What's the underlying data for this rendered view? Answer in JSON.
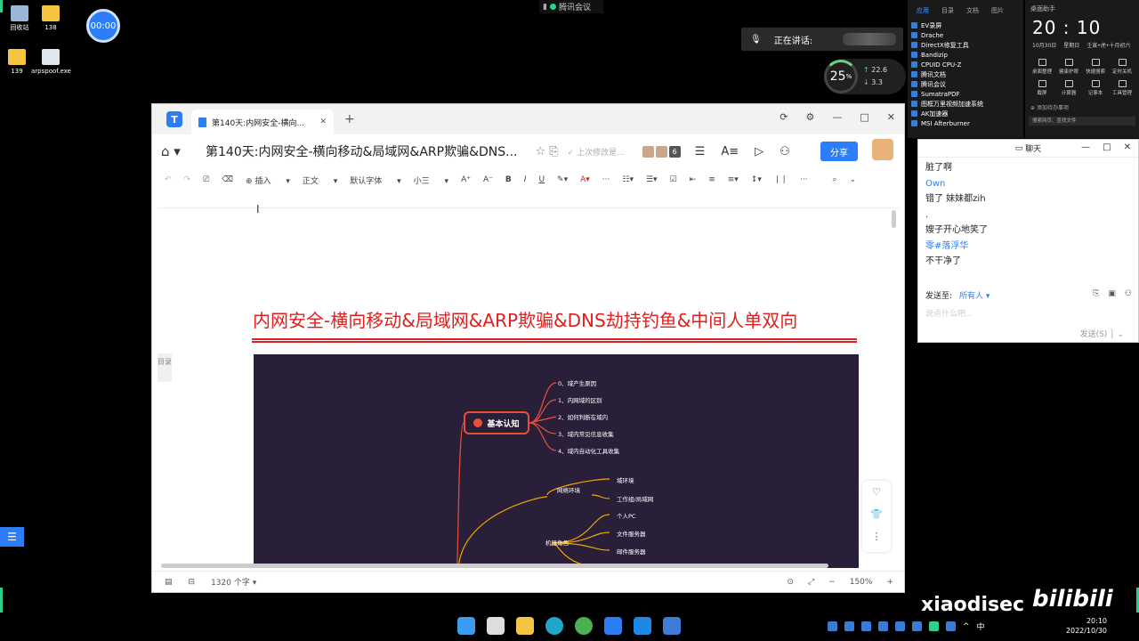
{
  "desktop": {
    "icons": [
      {
        "label": "回收站"
      },
      {
        "label": "138"
      },
      {
        "label": "139"
      },
      {
        "label": "arpspoof.exe"
      }
    ],
    "timer": "00:00"
  },
  "meeting": {
    "app_name": "腾讯会议",
    "speaking_label": "正在讲话:"
  },
  "perf": {
    "cpu": "25",
    "cpu_unit": "%",
    "up": "22.6",
    "down": "3.3"
  },
  "apps_panel": {
    "tabs": [
      "应用",
      "目录",
      "文档",
      "图片"
    ],
    "items": [
      "EV录屏",
      "Drache",
      "DirectX修复工具",
      "Bandizip",
      "CPUID CPU-Z",
      "腾讯文档",
      "腾讯会议",
      "SumatraPDF",
      "图框万里视频加速系统",
      "AK加速器",
      "MSI Afterburner"
    ]
  },
  "clock_panel": {
    "title": "桌面助手",
    "time": "20 : 10",
    "date": "10月30日",
    "weekday": "星期日",
    "lunar": "壬寅•虎•十月初六",
    "tools": [
      "桌面整理",
      "健康护眼",
      "快捷搜索",
      "定时关机",
      "截屏",
      "计算器",
      "记事本",
      "工具管理"
    ],
    "todo": "添加待办事项",
    "search_placeholder": "搜索网页、查找文件"
  },
  "chat": {
    "title": "聊天",
    "messages": [
      {
        "text": "脏了啊",
        "name": false
      },
      {
        "text": "Own",
        "name": true
      },
      {
        "text": "错了  妹妹都zih",
        "name": false
      },
      {
        "text": ".",
        "name": false
      },
      {
        "text": "嫂子开心地笑了",
        "name": false
      },
      {
        "text": "零#落浮华",
        "name": true
      },
      {
        "text": "不干净了",
        "name": false
      }
    ],
    "send_to_label": "发送至:",
    "send_to_value": "所有人",
    "input_placeholder": "说点什么吧...",
    "send_button": "发送(S)"
  },
  "doc_window": {
    "tab_title": "第140天:内网安全-横向...",
    "doc_title": "第140天:内网安全-横向移动&局域网&ARP欺骗&DNS...",
    "saved_status": "上次修改是...",
    "collaborators_count": "6",
    "share_button": "分享",
    "toolbar": {
      "insert": "插入",
      "style": "正文",
      "font": "默认字体",
      "size": "小三"
    },
    "heading": "内网安全-横向移动&局域网&ARP欺骗&DNS劫持钓鱼&中间人单双向",
    "toc_label": "目录",
    "word_count": "1320 个字",
    "zoom": "150%"
  },
  "mindmap": {
    "root": "基本认知",
    "branch1": [
      "0、域产生原因",
      "1、内网域的区别",
      "2、如何判断在域内",
      "3、域内常见信息收集",
      "4、域内自动化工具收集"
    ],
    "net_env": "网络环境",
    "net_items": [
      "域环境",
      "工作组/局域网"
    ],
    "roles": "机器角色",
    "role_items": [
      "个人PC",
      "文件服务器",
      "邮件服务器"
    ]
  },
  "taskbar": {
    "time": "20:10",
    "date": "2022/10/30",
    "ime": "中"
  },
  "watermark": "xiaodisec",
  "bili": "bilibili",
  "colors": {
    "accent": "#2d7df6",
    "heading_red": "#e02020",
    "mindmap_bg": "#2a1f38"
  }
}
